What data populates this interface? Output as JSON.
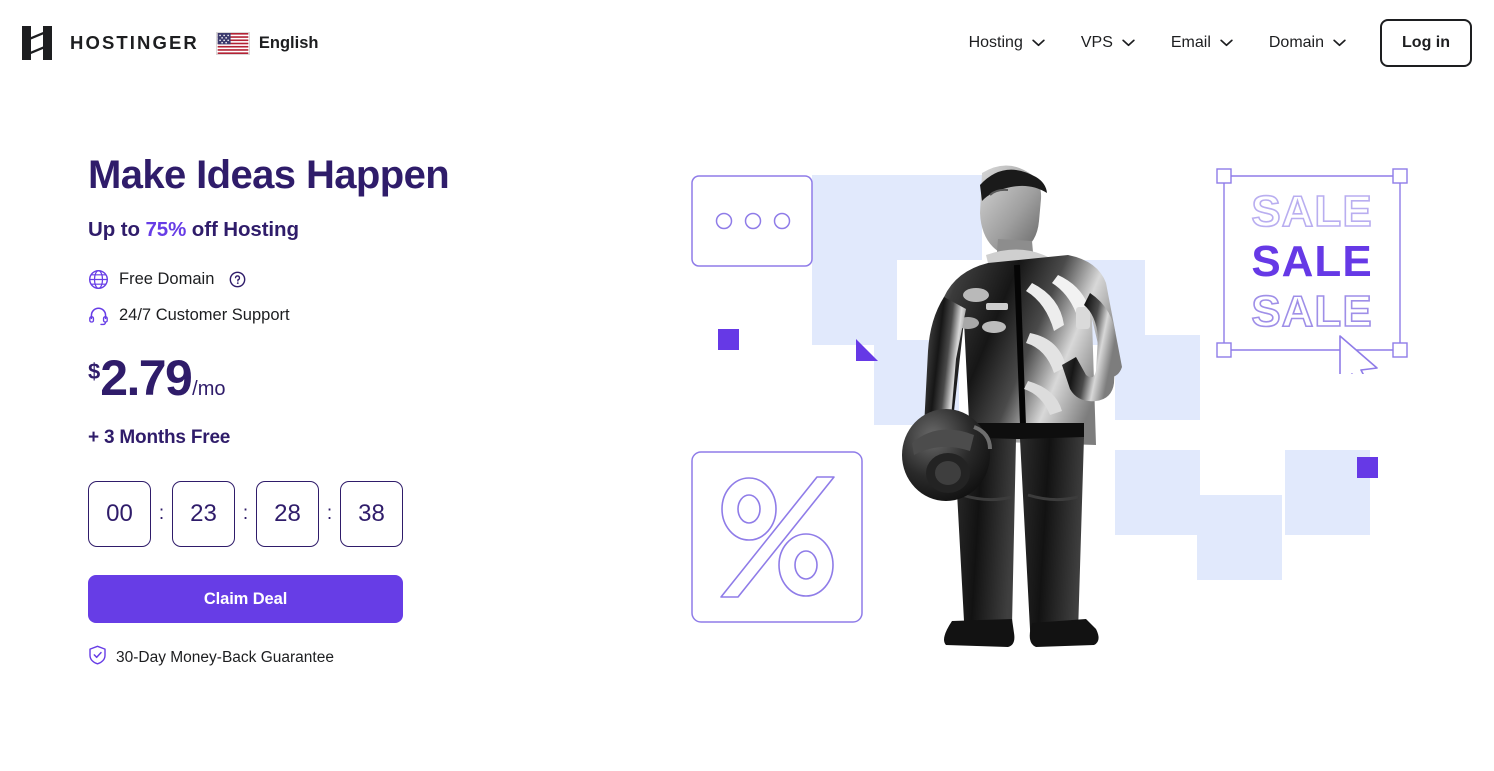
{
  "header": {
    "logo_icon": "hostinger-h-logo",
    "logo_text": "HOSTINGER",
    "language": {
      "flag_icon": "us-flag-icon",
      "label": "English"
    },
    "nav_items": [
      {
        "label": "Hosting",
        "icon": "chevron-down-icon"
      },
      {
        "label": "VPS",
        "icon": "chevron-down-icon"
      },
      {
        "label": "Email",
        "icon": "chevron-down-icon"
      },
      {
        "label": "Domain",
        "icon": "chevron-down-icon"
      }
    ],
    "login_label": "Log in"
  },
  "hero": {
    "headline": "Make Ideas Happen",
    "subhead_prefix": "Up to ",
    "subhead_percent": "75%",
    "subhead_suffix": " off Hosting",
    "features": [
      {
        "icon": "globe-icon",
        "label": "Free Domain",
        "help_icon": "question-circle-icon"
      },
      {
        "icon": "headset-icon",
        "label": "24/7 Customer Support"
      }
    ],
    "price": {
      "currency": "$",
      "amount": "2.79",
      "period": "/mo",
      "bonus": "+ 3 Months Free"
    },
    "timer": {
      "separator": ":",
      "units": [
        {
          "value": "00"
        },
        {
          "value": "23"
        },
        {
          "value": "28"
        },
        {
          "value": "38"
        }
      ]
    },
    "cta_label": "Claim Deal",
    "guarantee": {
      "icon": "shield-check-icon",
      "label": "30-Day Money-Back Guarantee"
    }
  },
  "illustration": {
    "browser_card_icon": "browser-window-card",
    "percent_card_icon": "percent-sign-card",
    "sale_labels": [
      "SALE",
      "SALE",
      "SALE"
    ],
    "cursor_icon": "mouse-cursor-icon",
    "selection_frame_icon": "selection-handles-frame",
    "photo_icon": "race-driver-photo",
    "triangle_icon": "violet-triangle",
    "accent_square_icon": "violet-square"
  },
  "colors": {
    "accent_violet": "#673de6",
    "deep_purple": "#2f1c6a",
    "light_lavender": "#e1e9fc",
    "outline_violet": "#8f7ce8",
    "ink": "#1d1e20"
  }
}
